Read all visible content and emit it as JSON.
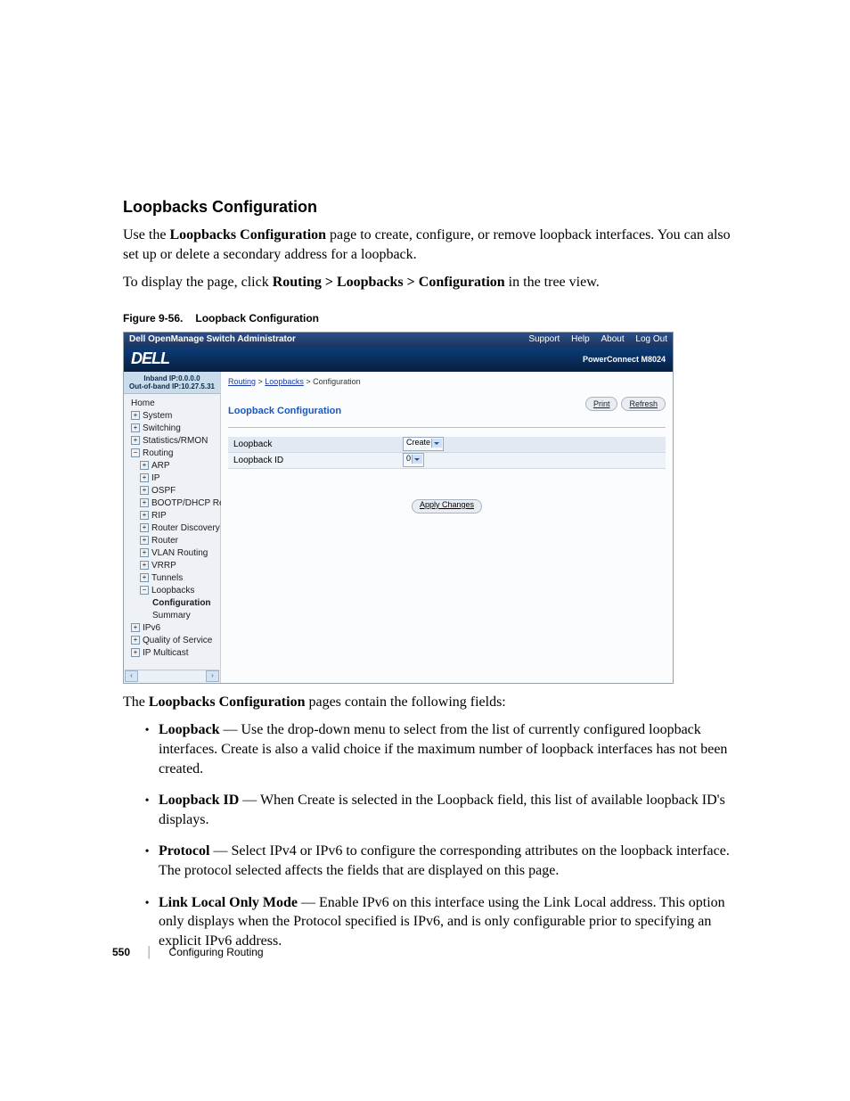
{
  "heading": "Loopbacks Configuration",
  "p1_pre": "Use the ",
  "p1_bold": "Loopbacks Configuration",
  "p1_post": " page to create, configure, or remove loopback interfaces. You can also set up or delete a secondary address for a loopback.",
  "p2_pre": "To display the page, click ",
  "p2_bold": "Routing > Loopbacks > Configuration",
  "p2_post": " in the tree view.",
  "fig_num": "Figure 9-56.",
  "fig_title": "Loopback Configuration",
  "shot": {
    "title": "Dell OpenManage Switch Administrator",
    "links": {
      "support": "Support",
      "help": "Help",
      "about": "About",
      "logout": "Log Out"
    },
    "logo": "DELL",
    "product": "PowerConnect M8024",
    "ip_in": "Inband IP:0.0.0.0",
    "ip_out": "Out-of-band IP:10.27.5.31",
    "tree": {
      "home": "Home",
      "system": "System",
      "switching": "Switching",
      "stats": "Statistics/RMON",
      "routing": "Routing",
      "arp": "ARP",
      "ip": "IP",
      "ospf": "OSPF",
      "bootp": "BOOTP/DHCP Relay Ag",
      "rip": "RIP",
      "rdisc": "Router Discovery",
      "router": "Router",
      "vlan": "VLAN Routing",
      "vrrp": "VRRP",
      "tunnels": "Tunnels",
      "loopbacks": "Loopbacks",
      "config": "Configuration",
      "summary": "Summary",
      "ipv6": "IPv6",
      "qos": "Quality of Service",
      "ipmc": "IP Multicast"
    },
    "crumb": {
      "a": "Routing",
      "b": "Loopbacks",
      "c": "Configuration"
    },
    "panel_title": "Loopback Configuration",
    "btn": {
      "print": "Print",
      "refresh": "Refresh",
      "apply": "Apply Changes"
    },
    "row1": {
      "label": "Loopback",
      "value": "Create"
    },
    "row2": {
      "label": "Loopback ID",
      "value": "0"
    }
  },
  "afterfig_pre": "The ",
  "afterfig_bold": "Loopbacks Configuration",
  "afterfig_post": " pages contain the following fields:",
  "fields": [
    {
      "name": "Loopback",
      "desc": " — Use the drop-down menu to select from the list of currently configured loopback interfaces. Create is also a valid choice if the maximum number of loopback interfaces has not been created."
    },
    {
      "name": "Loopback ID",
      "desc": " — When Create is selected in the Loopback field, this list of available loopback ID's displays."
    },
    {
      "name": "Protocol",
      "desc": " — Select IPv4 or IPv6 to configure the corresponding attributes on the loopback interface. The protocol selected affects the fields that are displayed on this page."
    },
    {
      "name": "Link Local Only Mode",
      "desc": " — Enable IPv6 on this interface using the Link Local address. This option only displays when the Protocol specified is IPv6, and is only configurable prior to specifying an explicit IPv6 address."
    }
  ],
  "footer": {
    "page": "550",
    "section": "Configuring Routing"
  }
}
